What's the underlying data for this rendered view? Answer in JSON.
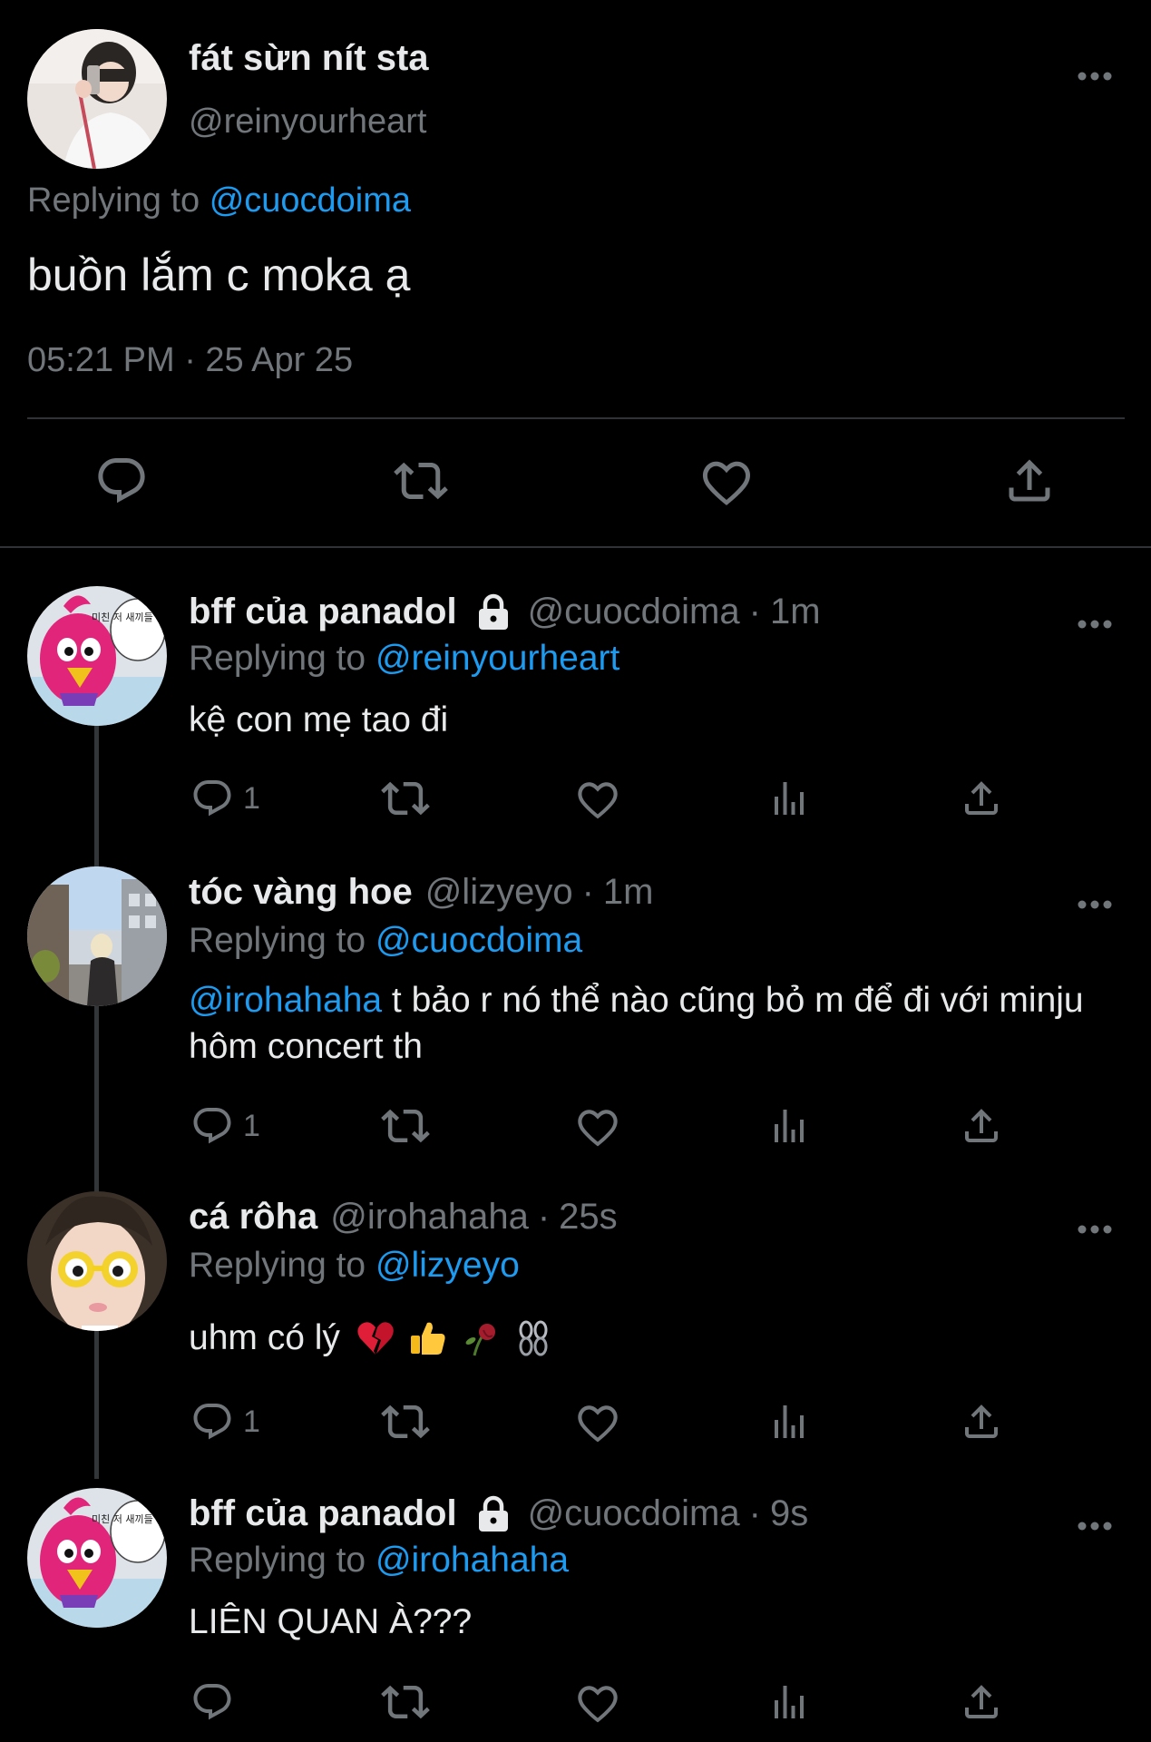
{
  "main_tweet": {
    "display_name": "fát sừn nít sta",
    "handle": "@reinyourheart",
    "replying_prefix": "Replying to",
    "replying_to": "@cuocdoima",
    "text": "buồn lắm c moka ạ",
    "timestamp": "05:21 PM · 25 Apr 25",
    "actions": [
      "reply-icon",
      "retweet-icon",
      "like-icon",
      "share-icon"
    ]
  },
  "replies": [
    {
      "display_name": "bff của panadol",
      "protected": true,
      "handle": "@cuocdoima",
      "time": "1m",
      "replying_prefix": "Replying to",
      "replying_to": "@reinyourheart",
      "text": "kệ con mẹ tao đi",
      "reply_count": "1",
      "avatar_bubble_text": "미친 저 새끼들 워해..."
    },
    {
      "display_name": "tóc vàng hoe",
      "protected": false,
      "handle": "@lizyeyo",
      "time": "1m",
      "replying_prefix": "Replying to",
      "replying_to": "@cuocdoima",
      "mention": "@irohahaha",
      "text": "t bảo r nó thể nào cũng bỏ m để đi với minju hôm concert th",
      "reply_count": "1"
    },
    {
      "display_name": "cá rôha",
      "protected": false,
      "handle": "@irohahaha",
      "time": "25s",
      "replying_prefix": "Replying to",
      "replying_to": "@lizyeyo",
      "text": "uhm có lý",
      "emojis": [
        "broken-heart-emoji",
        "thumbs-up-emoji",
        "wilted-rose-emoji",
        "chains-emoji"
      ],
      "reply_count": "1"
    },
    {
      "display_name": "bff của panadol",
      "protected": true,
      "handle": "@cuocdoima",
      "time": "9s",
      "replying_prefix": "Replying to",
      "replying_to": "@irohahaha",
      "text": "LIÊN QUAN À???",
      "reply_count": "",
      "avatar_bubble_text": "미친 저 새끼들 워해..."
    }
  ],
  "colors": {
    "background": "#000000",
    "text_primary": "#e7e9ea",
    "text_muted": "#71767b",
    "link": "#1d9bf0",
    "divider": "#2f3336"
  }
}
